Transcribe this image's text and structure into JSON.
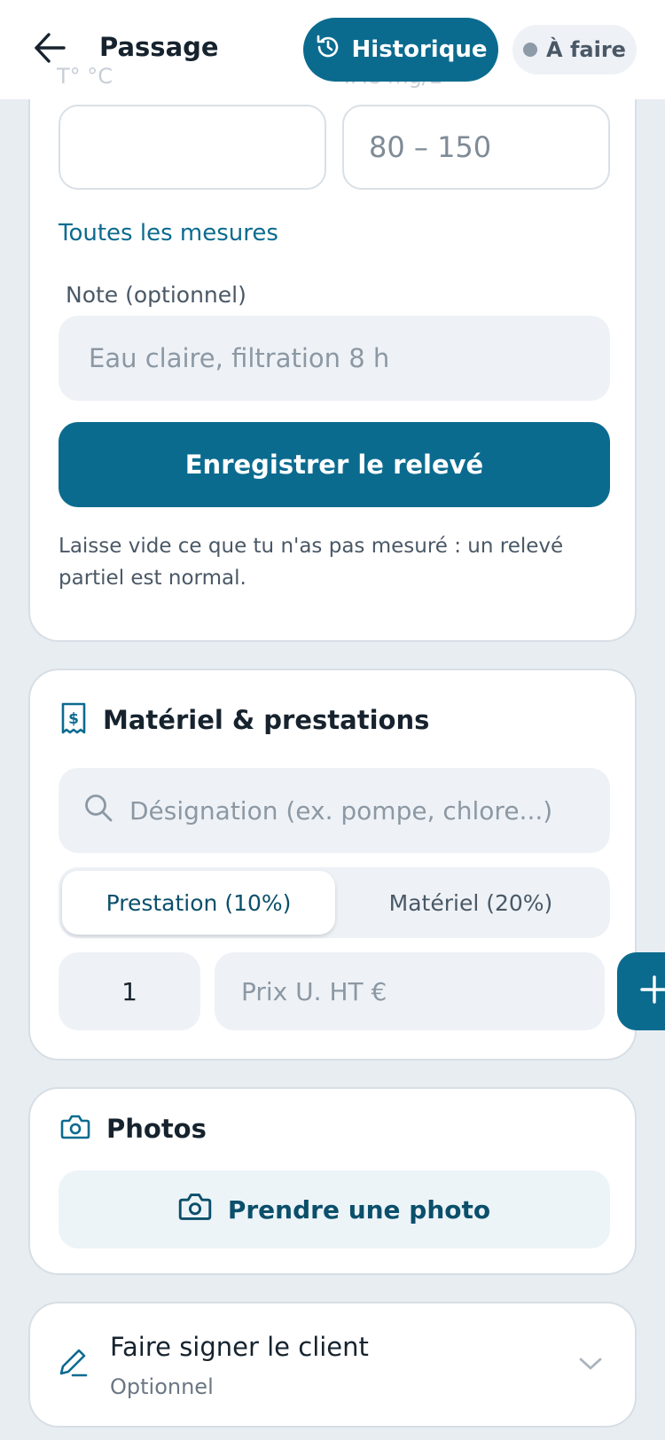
{
  "header": {
    "title": "Passage",
    "history_label": "Historique",
    "status_label": "À faire"
  },
  "releve": {
    "hidden_label_left": "T° °C",
    "hidden_label_right": "TAC mg/L",
    "field_left_value": "",
    "field_right_placeholder": "80 – 150",
    "all_measures_link": "Toutes les mesures",
    "note_label": "Note (optionnel)",
    "note_placeholder": "Eau claire, filtration 8 h",
    "save_label": "Enregistrer le relevé",
    "hint": "Laisse vide ce que tu n'as pas mesuré : un relevé partiel est normal."
  },
  "materiel": {
    "title": "Matériel & prestations",
    "search_placeholder": "Désignation (ex. pompe, chlore...)",
    "tabs": [
      {
        "label": "Prestation (10%)",
        "active": true
      },
      {
        "label": "Matériel (20%)",
        "active": false
      }
    ],
    "quantity": "1",
    "price_placeholder": "Prix U. HT €"
  },
  "photos": {
    "title": "Photos",
    "take_photo_label": "Prendre une photo"
  },
  "signature": {
    "title": "Faire signer le client",
    "subtitle": "Optionnel"
  },
  "colors": {
    "accent": "#0b6b8f",
    "background": "#e8edf2",
    "card": "#ffffff",
    "input": "#eef2f7"
  },
  "icons": {
    "back": "arrow-left-icon",
    "history": "history-icon",
    "status": "status-dot-icon",
    "receipt": "receipt-dollar-icon",
    "search": "search-icon",
    "add": "plus-icon",
    "camera": "camera-icon",
    "sign": "pen-icon",
    "expand": "chevron-down-icon"
  }
}
